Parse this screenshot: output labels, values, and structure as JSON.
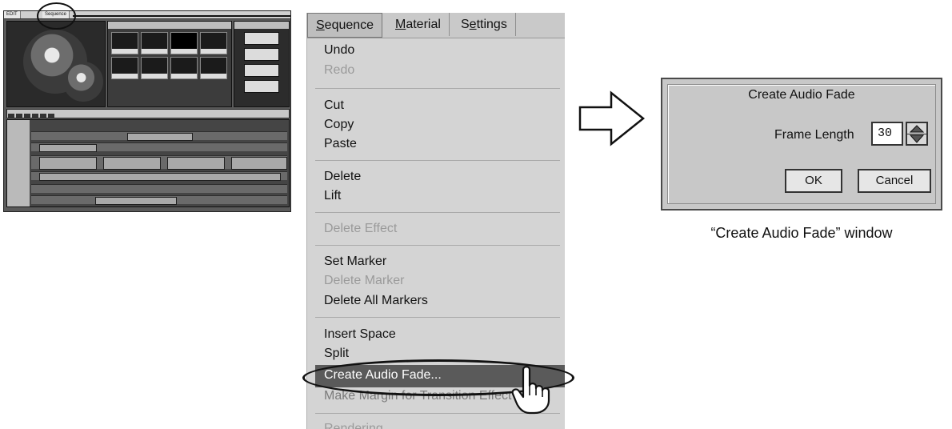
{
  "editor_thumbnail": {
    "menu_tabs": [
      "EDIT",
      "Sequence"
    ]
  },
  "menu": {
    "titles": [
      {
        "label": "Sequence",
        "mnemonic": "S",
        "rest": "equence"
      },
      {
        "label": "Material",
        "mnemonic": "M",
        "rest": "aterial"
      },
      {
        "label": "Settings",
        "pre": "S",
        "mnemonic": "e",
        "rest": "ttings"
      }
    ],
    "items": {
      "undo": "Undo",
      "redo": "Redo",
      "cut": "Cut",
      "copy": "Copy",
      "paste": "Paste",
      "delete": "Delete",
      "lift": "Lift",
      "delete_effect": "Delete Effect",
      "set_marker": "Set Marker",
      "delete_marker": "Delete Marker",
      "delete_all_markers": "Delete All Markers",
      "insert_space": "Insert Space",
      "split": "Split",
      "create_audio_fade": "Create Audio Fade...",
      "make_margin": "Make Margin for Transition Effect",
      "rendering": "Rendering"
    }
  },
  "dialog": {
    "title": "Create Audio Fade",
    "frame_length_label": "Frame Length",
    "frame_length_value": "30",
    "ok_label": "OK",
    "cancel_label": "Cancel"
  },
  "caption": "“Create Audio Fade” window"
}
